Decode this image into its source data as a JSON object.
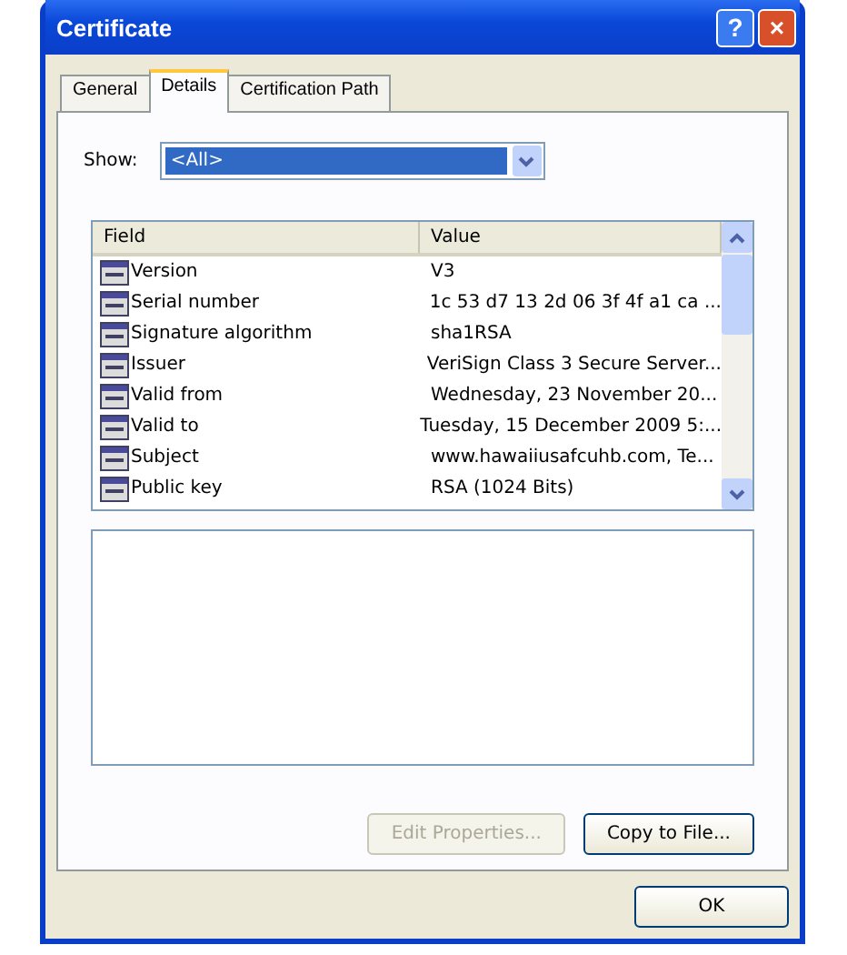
{
  "window": {
    "title": "Certificate"
  },
  "title_buttons": [
    {
      "kind": "help",
      "label": "?"
    },
    {
      "kind": "close",
      "label": "×"
    }
  ],
  "tabs": [
    {
      "label": "General",
      "selected": false
    },
    {
      "label": "Details",
      "selected": true
    },
    {
      "label": "Certification Path",
      "selected": false
    }
  ],
  "show": {
    "label": "Show:",
    "value": "<All>"
  },
  "table": {
    "columns": [
      "Field",
      "Value"
    ],
    "rows": [
      {
        "field": "Version",
        "value": "V3"
      },
      {
        "field": "Serial number",
        "value": "1c 53 d7 13 2d 06 3f 4f a1 ca ..."
      },
      {
        "field": "Signature algorithm",
        "value": "sha1RSA"
      },
      {
        "field": "Issuer",
        "value": "VeriSign Class 3 Secure Server..."
      },
      {
        "field": "Valid from",
        "value": "Wednesday, 23 November 20..."
      },
      {
        "field": "Valid to",
        "value": "Tuesday, 15 December 2009 5:..."
      },
      {
        "field": "Subject",
        "value": "www.hawaiiusafcuhb.com, Te..."
      },
      {
        "field": "Public key",
        "value": "RSA (1024 Bits)"
      }
    ]
  },
  "buttons": [
    {
      "label": "Edit Properties...",
      "disabled": true
    },
    {
      "label": "Copy to File...",
      "disabled": false
    }
  ],
  "ok": {
    "label": "OK"
  }
}
